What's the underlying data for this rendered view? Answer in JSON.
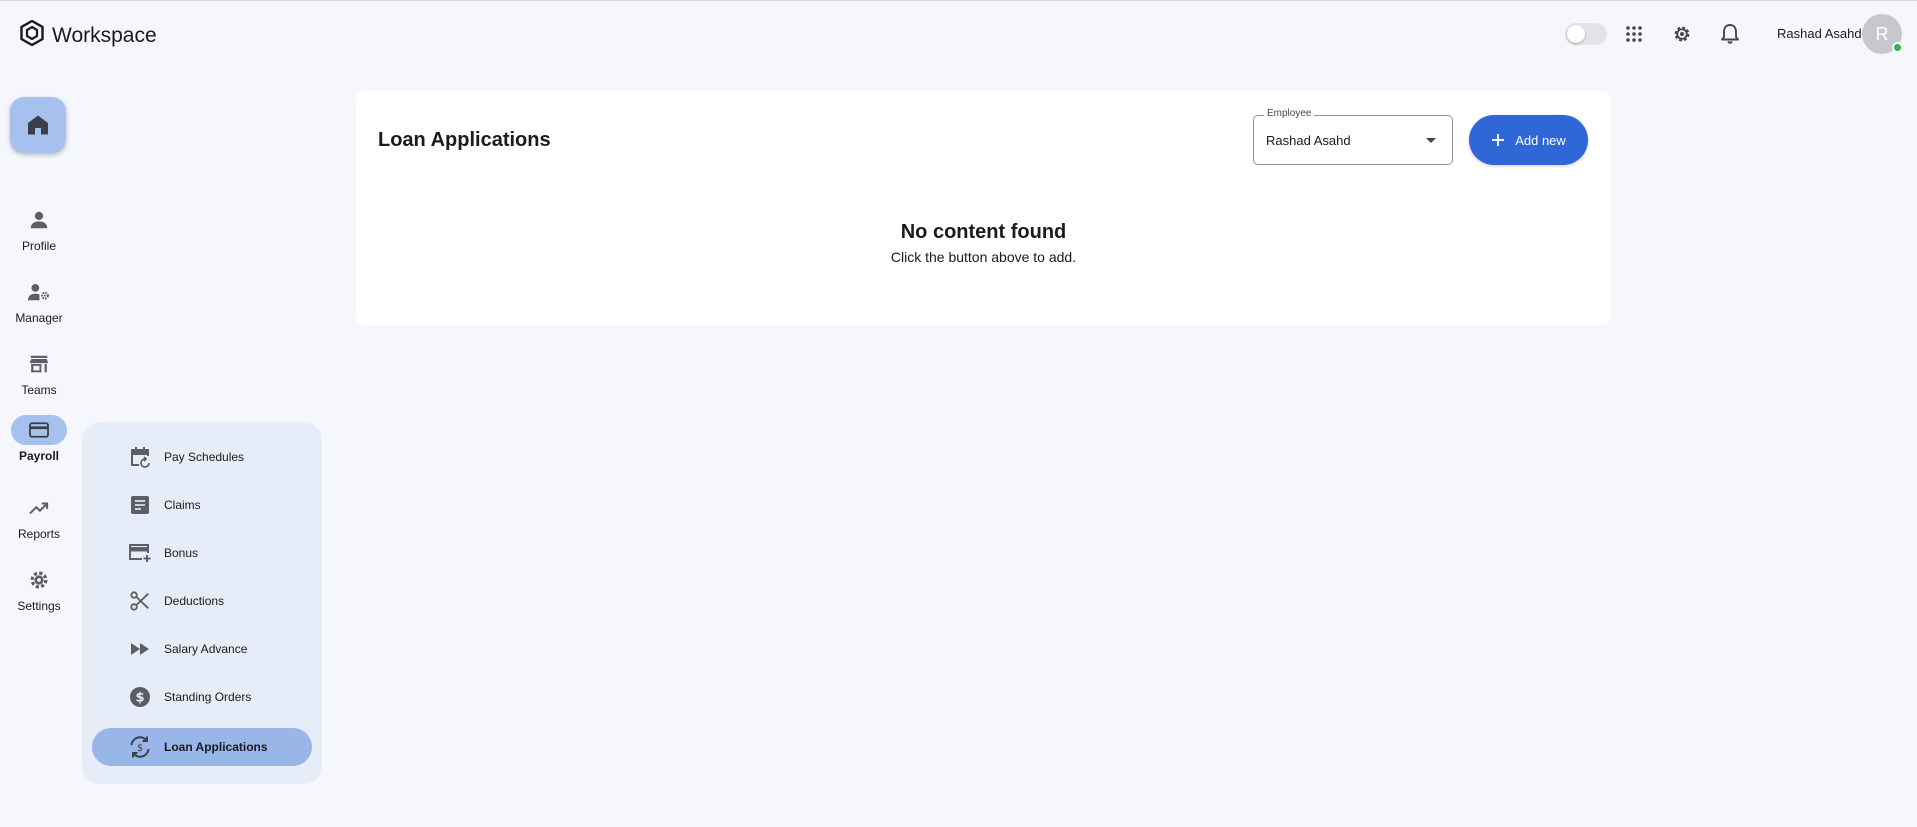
{
  "app": {
    "title": "Workspace"
  },
  "header": {
    "user_name": "Rashad Asahd",
    "avatar_initial": "R",
    "icons": [
      "theme-toggle",
      "apps-grid-icon",
      "gear-icon",
      "bell-icon"
    ]
  },
  "rail": {
    "items": [
      {
        "label": "Profile",
        "icon": "person-icon"
      },
      {
        "label": "Manager",
        "icon": "manager-icon"
      },
      {
        "label": "Teams",
        "icon": "store-icon"
      },
      {
        "label": "Payroll",
        "icon": "card-icon",
        "active": true
      },
      {
        "label": "Reports",
        "icon": "trending-up-icon"
      },
      {
        "label": "Settings",
        "icon": "gear-icon"
      }
    ]
  },
  "submenu": {
    "items": [
      {
        "label": "Pay Schedules",
        "icon": "calendar-refresh-icon"
      },
      {
        "label": "Claims",
        "icon": "document-icon"
      },
      {
        "label": "Bonus",
        "icon": "card-plus-icon"
      },
      {
        "label": "Deductions",
        "icon": "scissors-icon"
      },
      {
        "label": "Salary Advance",
        "icon": "fast-forward-icon"
      },
      {
        "label": "Standing Orders",
        "icon": "dollar-circle-icon"
      },
      {
        "label": "Loan Applications",
        "icon": "dollar-sync-icon",
        "active": true
      }
    ]
  },
  "main": {
    "title": "Loan Applications",
    "employee_select": {
      "label": "Employee",
      "value": "Rashad Asahd"
    },
    "add_button": "Add new",
    "empty_title": "No content found",
    "empty_subtitle": "Click the button above to add."
  },
  "colors": {
    "accent": "#3067d6",
    "active_nav": "#a7c1ef",
    "submenu_bg": "#e6ecf8",
    "online_status": "#2fb344"
  }
}
